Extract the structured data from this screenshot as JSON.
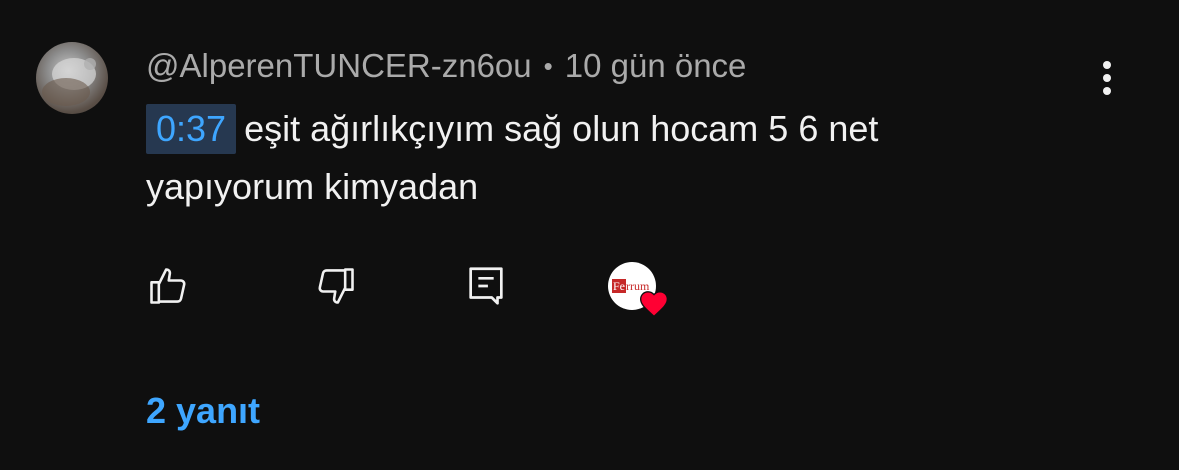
{
  "comment": {
    "author": "@AlperenTUNCER-zn6ou",
    "separator": "•",
    "time_ago": "10 gün önce",
    "timestamp_link": "0:37",
    "text_line1": "eşit ağırlıkçıyım sağ olun hocam 5 6 net",
    "text_line2": "yapıyorum kimyadan"
  },
  "actions": {
    "like_icon": "thumbs-up-icon",
    "dislike_icon": "thumbs-down-icon",
    "reply_icon": "reply-comment-icon",
    "creator_heart": {
      "brand_prefix": "Fe",
      "brand_suffix": "rrum",
      "heart_color": "#ff0033"
    }
  },
  "menu_icon": "more-vertical-icon",
  "replies": {
    "label": "2 yanıt"
  },
  "colors": {
    "background": "#0f0f0f",
    "link": "#3ea6ff",
    "secondary_text": "#aaaaaa",
    "timestamp_bg": "#263850"
  }
}
